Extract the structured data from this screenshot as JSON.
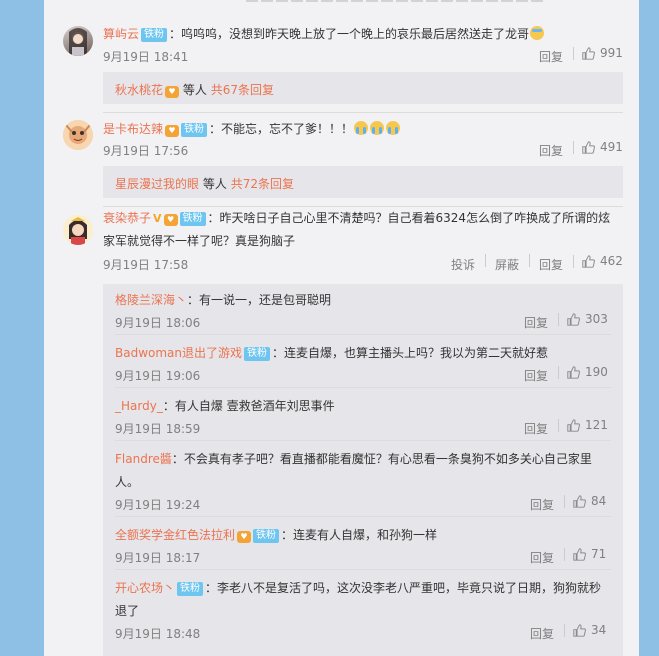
{
  "c1": {
    "name": "算屿云",
    "badge": "铁粉",
    "text": "：呜呜呜，没想到昨天晚上放了一个晚上的哀乐最后居然送走了龙哥",
    "time": "9月19日 18:41",
    "reply": "回复",
    "likes": "991",
    "sub": {
      "who": "秋水桃花",
      "mid": "等人",
      "count": "共67条回复"
    }
  },
  "c2": {
    "name": "是卡布达辣",
    "badge": "铁粉",
    "text": "：不能忘，忘不了爹！！！",
    "time": "9月19日 17:56",
    "reply": "回复",
    "likes": "491",
    "sub": {
      "who": "星辰漫过我的眼",
      "mid": "等人",
      "count": "共72条回复"
    }
  },
  "c3": {
    "name": "衰染恭子",
    "badge": "铁粉",
    "text1": "：昨天啥日子自己心里不清楚吗？自己看着6324怎么倒了咋换成了所谓的炫",
    "text2": "家军就觉得不一样了呢？真是狗脑子",
    "time": "9月19日 17:58",
    "report": "投诉",
    "block": "屏蔽",
    "reply": "回复",
    "likes": "462"
  },
  "replies": [
    {
      "name": "格陵兰深海丶",
      "text": "：有一说一，还是包哥聪明",
      "time": "9月19日 18:06",
      "reply": "回复",
      "likes": "303"
    },
    {
      "name": "Badwoman退出了游戏",
      "badge": "铁粉",
      "text": "：连麦自爆，也算主播头上吗？我以为第二天就好惹",
      "time": "9月19日 19:06",
      "reply": "回复",
      "likes": "190"
    },
    {
      "name": "_Hardy_",
      "text": "：有人自爆 壹救爸酒年刘思事件",
      "time": "9月19日 18:59",
      "reply": "回复",
      "likes": "121"
    },
    {
      "name": "Flandre醬",
      "text1": "：不会真有孝子吧？看直播都能看魔怔？有心思看一条臭狗不如多关心自己家里",
      "text2": "人。",
      "time": "9月19日 19:24",
      "reply": "回复",
      "likes": "84"
    },
    {
      "name": "全额奖学金红色法拉利",
      "badge": "铁粉",
      "text": "：连麦有人自爆，和孙狗一样",
      "time": "9月19日 18:17",
      "reply": "回复",
      "likes": "71"
    },
    {
      "name": "开心农场丶",
      "badge": "铁粉",
      "text1": "：李老八不是复活了吗，这次没李老八严重吧，毕竟只说了日期，狗狗就秒",
      "text2": "退了",
      "time": "9月19日 18:48",
      "reply": "回复",
      "likes": "34"
    }
  ]
}
